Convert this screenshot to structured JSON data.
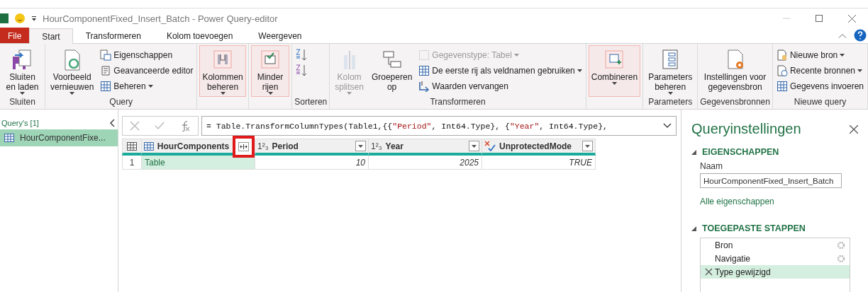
{
  "window": {
    "title": "HourComponentFixed_Insert_Batch - Power Query-editor"
  },
  "tabs": [
    {
      "label": "File",
      "kind": "file",
      "selected": false
    },
    {
      "label": "Start",
      "kind": "tab",
      "selected": true
    },
    {
      "label": "Transformeren",
      "kind": "tab",
      "selected": false
    },
    {
      "label": "Kolom toevoegen",
      "kind": "tab",
      "selected": false
    },
    {
      "label": "Weergeven",
      "kind": "tab",
      "selected": false
    }
  ],
  "ribbon": {
    "groups": [
      {
        "label": "Sluiten",
        "buttons": [
          {
            "kind": "large",
            "label": "Sluiten en laden",
            "caret": true,
            "highlighted": false,
            "disabled": false
          }
        ]
      },
      {
        "label": "Query",
        "buttons": [
          {
            "kind": "large",
            "label": "Voorbeeld vernieuwen",
            "caret": true,
            "highlighted": false,
            "disabled": false
          },
          {
            "kind": "small",
            "label": "Eigenschappen",
            "caret": false,
            "disabled": false
          },
          {
            "kind": "small",
            "label": "Geavanceerde editor",
            "caret": false,
            "disabled": false
          },
          {
            "kind": "small",
            "label": "Beheren",
            "caret": true,
            "disabled": false
          }
        ]
      },
      {
        "buttons": [
          {
            "kind": "large",
            "label": "Kolommen beheren",
            "caret": true,
            "highlighted": true,
            "disabled": false
          }
        ]
      },
      {
        "buttons": [
          {
            "kind": "large",
            "label": "Minder rijen",
            "caret": true,
            "highlighted": true,
            "disabled": false
          }
        ]
      },
      {
        "label": "Sorteren",
        "buttons": [
          {
            "kind": "sort"
          }
        ]
      },
      {
        "label": "Transformeren",
        "buttons": [
          {
            "kind": "large",
            "label": "Kolom splitsen",
            "caret": true,
            "highlighted": false,
            "disabled": true
          },
          {
            "kind": "large",
            "label": "Groeperen op",
            "caret": false,
            "highlighted": false,
            "disabled": false
          },
          {
            "kind": "small",
            "label": "Gegevenstype: Tabel",
            "caret": true,
            "disabled": true
          },
          {
            "kind": "small",
            "label": "De eerste rij als veldnamen gebruiken",
            "caret": true,
            "disabled": false
          },
          {
            "kind": "small",
            "label": "Waarden vervangen",
            "caret": false,
            "disabled": false
          }
        ]
      },
      {
        "buttons": [
          {
            "kind": "large",
            "label": "Combineren",
            "caret": true,
            "highlighted": true,
            "disabled": false
          }
        ]
      },
      {
        "label": "Parameters",
        "buttons": [
          {
            "kind": "large",
            "label": "Parameters beheren",
            "caret": true,
            "highlighted": false,
            "disabled": false
          }
        ]
      },
      {
        "label": "Gegevensbronnen",
        "buttons": [
          {
            "kind": "large",
            "label": "Instellingen voor gegevensbron",
            "caret": false,
            "highlighted": false,
            "disabled": false
          }
        ]
      },
      {
        "label": "Nieuwe query",
        "buttons": [
          {
            "kind": "small",
            "label": "Nieuwe bron",
            "caret": true,
            "disabled": false
          },
          {
            "kind": "small",
            "label": "Recente bronnen",
            "caret": true,
            "disabled": false
          },
          {
            "kind": "small",
            "label": "Gegevens invoeren",
            "caret": false,
            "disabled": false
          }
        ]
      }
    ]
  },
  "queries": {
    "header": "Query's [1]",
    "items": [
      {
        "label": "HourComponentFixe...",
        "selected": true
      }
    ]
  },
  "formula": {
    "parts": [
      {
        "kind": "code",
        "text": "= Table.TransformColumnTypes(Table1,{{"
      },
      {
        "kind": "string",
        "text": "\"Period\""
      },
      {
        "kind": "code",
        "text": ", Int64.Type}, {"
      },
      {
        "kind": "string",
        "text": "\"Year\""
      },
      {
        "kind": "code",
        "text": ", Int64.Type},"
      }
    ]
  },
  "table": {
    "columns": [
      {
        "name": "HourComponents",
        "kind": "table",
        "expand_highlighted": true
      },
      {
        "name": "Period",
        "kind": "number",
        "type_label": "1²₃"
      },
      {
        "name": "Year",
        "kind": "number",
        "type_label": "1²₃"
      },
      {
        "name": "UnprotectedMode",
        "kind": "any"
      }
    ],
    "rows": [
      {
        "number": "1",
        "cells": [
          "Table",
          "10",
          "2025",
          "TRUE"
        ]
      }
    ]
  },
  "settings": {
    "title": "Queryinstellingen",
    "properties_header": "EIGENSCHAPPEN",
    "name_label": "Naam",
    "name_value": "HourComponentFixed_Insert_Batch",
    "all_properties_link": "Alle eigenschappen",
    "steps_header": "TOEGEPASTE STAPPEN",
    "steps": [
      {
        "label": "Bron",
        "selected": false,
        "has_settings": true
      },
      {
        "label": "Navigatie",
        "selected": false,
        "has_settings": true
      },
      {
        "label": "Type gewijzigd",
        "selected": true,
        "has_settings": false
      }
    ]
  }
}
